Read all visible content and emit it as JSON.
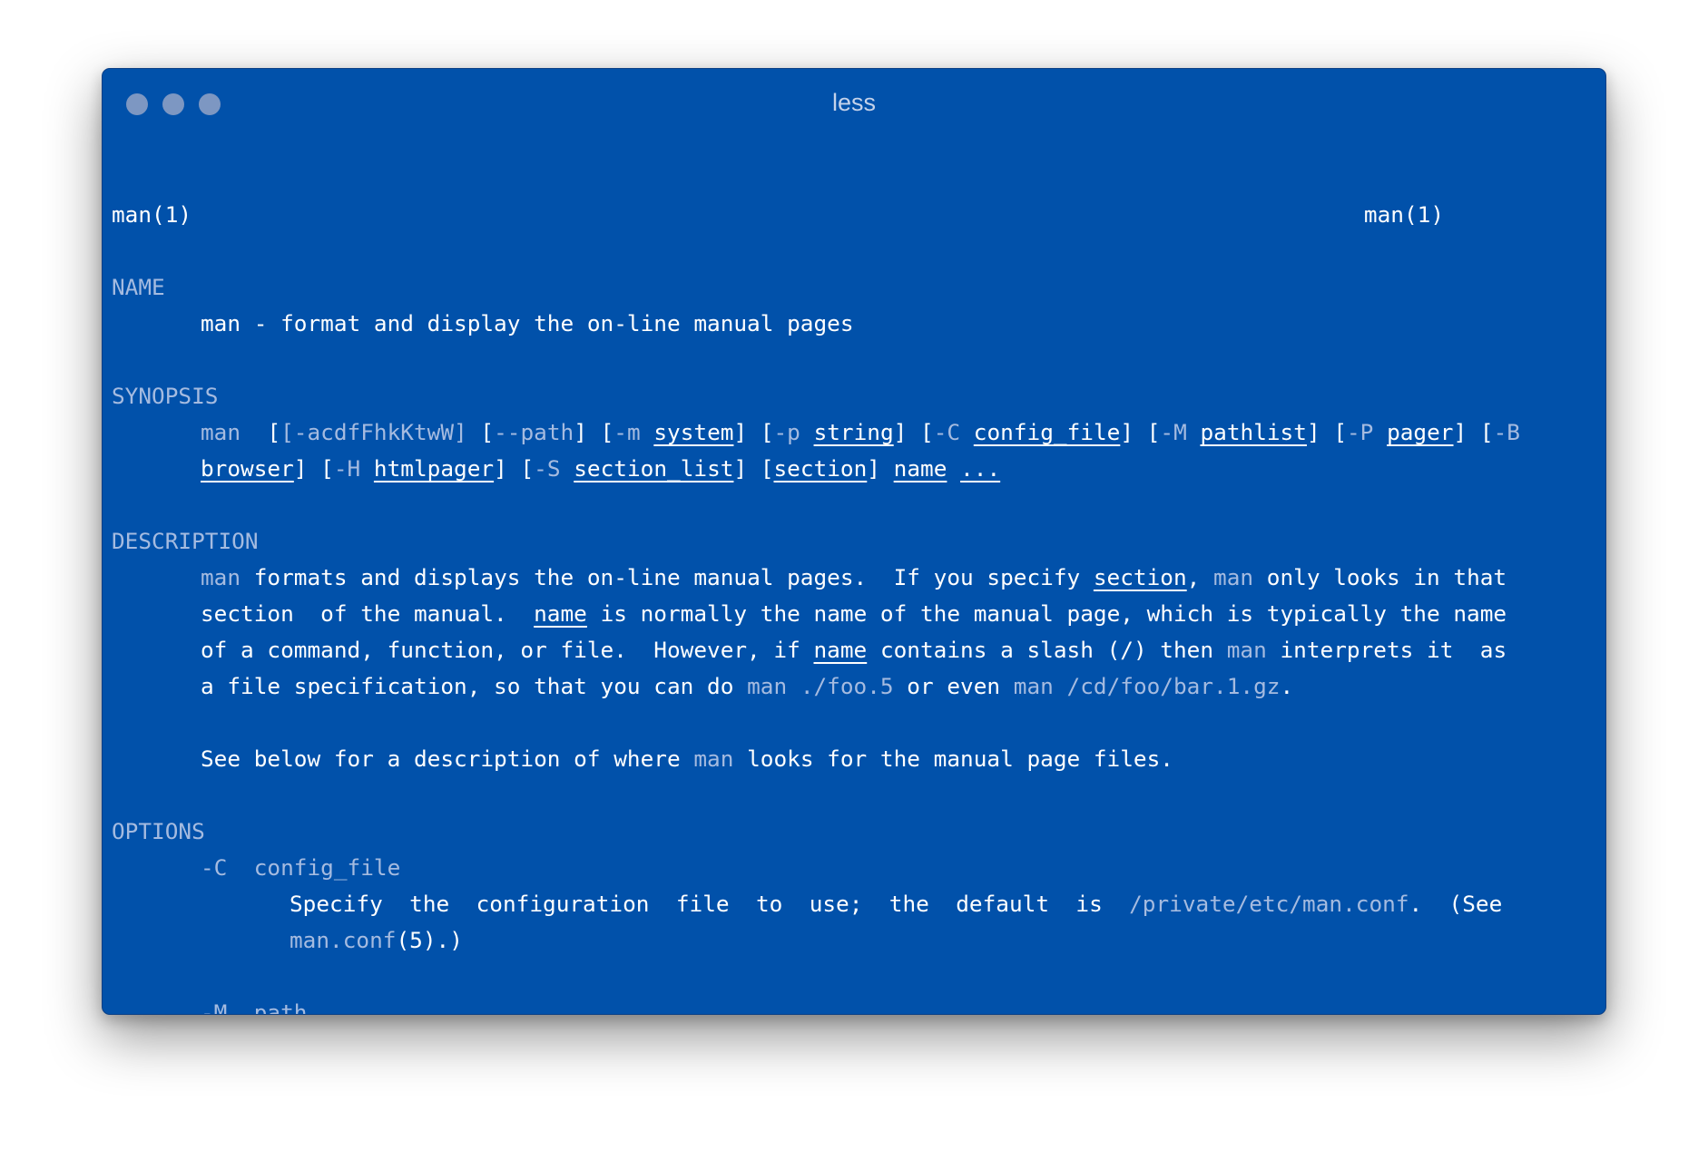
{
  "window": {
    "title": "less"
  },
  "manpage": {
    "header_left": "man(1)",
    "header_right": "man(1)",
    "name_heading": "NAME",
    "name_text": "man - format and display the on-line manual pages",
    "synopsis_heading": "SYNOPSIS",
    "synopsis": {
      "cmd": "man",
      "flags": "[-acdfFhkKtwW]",
      "path_open": "[",
      "path_flag": "--path",
      "path_close": "]",
      "m_open": "[",
      "m_flag": "-m",
      "m_arg": "system",
      "m_close": "]",
      "p_open": "[",
      "p_flag": "-p",
      "p_arg": "string",
      "p_close": "]",
      "c_open": "[",
      "c_flag": "-C",
      "c_arg": "config_file",
      "c_close": "]",
      "mm_open": "[",
      "mm_flag": "-M",
      "mm_arg": "pathlist",
      "mm_close": "]",
      "pp_open": "[",
      "pp_flag": "-P",
      "pp_arg": "pager",
      "pp_close": "]",
      "b_open": "[",
      "b_flag": "-B",
      "b_arg": "browser",
      "b_close": "]",
      "h_open": "[",
      "h_flag": "-H",
      "h_arg": "htmlpager",
      "h_close": "]",
      "s_open": "[",
      "s_flag": "-S",
      "s_arg": "section_list",
      "s_close": "]",
      "section_open": "[",
      "section_arg": "section",
      "section_close": "]",
      "name_arg": "name",
      "ellipsis": "..."
    },
    "description_heading": "DESCRIPTION",
    "description": {
      "l1_cmd": "man",
      "l1_text": "formats and displays the on-line manual pages.  If you specify",
      "l1_section": "section",
      "l1_comma": ",",
      "l1_cmd2": "man",
      "l1_end": "only looks in that",
      "l2_text": "section  of the manual.",
      "l2_name": "name",
      "l2_end": "is normally the name of the manual page, which is typically the name",
      "l3_text": "of a command, function, or file.  However, if",
      "l3_name": "name",
      "l3_mid": "contains a slash (/) then",
      "l3_cmd": "man",
      "l3_end": "interprets it  as",
      "l4_text": "a file specification, so that you can do",
      "l4_ex1": "man ./foo.5",
      "l4_mid": "or even",
      "l4_ex2": "man /cd/foo/bar.1.gz",
      "l4_end": ".",
      "l5_text": "See below for a description of where",
      "l5_cmd": "man",
      "l5_end": "looks for the manual page files."
    },
    "options_heading": "OPTIONS",
    "options": {
      "c_flag": "-C",
      "c_arg": "config_file",
      "c_desc": "Specify  the  configuration  file  to  use;  the  default  is",
      "c_path": "/private/etc/man.conf",
      "c_desc_end": ".  (See",
      "c_ref_cmd": "man.conf",
      "c_ref_end": "(5).)",
      "m_flag": "-M",
      "m_arg": "path"
    },
    "prompt": ":"
  }
}
